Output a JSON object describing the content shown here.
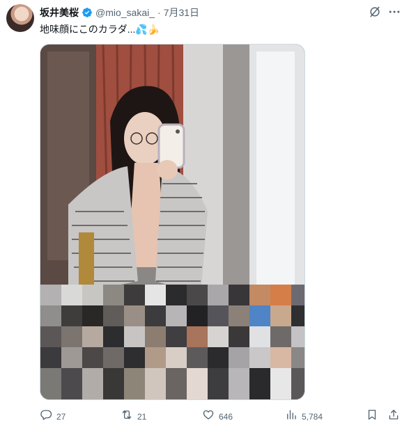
{
  "author": {
    "display_name": "坂井美桜",
    "handle": "@mio_sakai_",
    "separator": "·",
    "date": "7月31日",
    "verified": true
  },
  "tweet": {
    "text": "地味顔にこのカラダ...💦🍌"
  },
  "actions": {
    "reply_count": "27",
    "retweet_count": "21",
    "like_count": "646",
    "views_count": "5,784"
  },
  "icons": {
    "verified": "verified-badge-icon",
    "grok": "grok-icon",
    "more": "more-icon",
    "reply": "reply-icon",
    "retweet": "retweet-icon",
    "like": "heart-icon",
    "views": "views-icon",
    "bookmark": "bookmark-icon",
    "share": "share-icon"
  },
  "colors": {
    "text_primary": "#0f1419",
    "text_secondary": "#536471",
    "verified_blue": "#1d9bf0"
  }
}
